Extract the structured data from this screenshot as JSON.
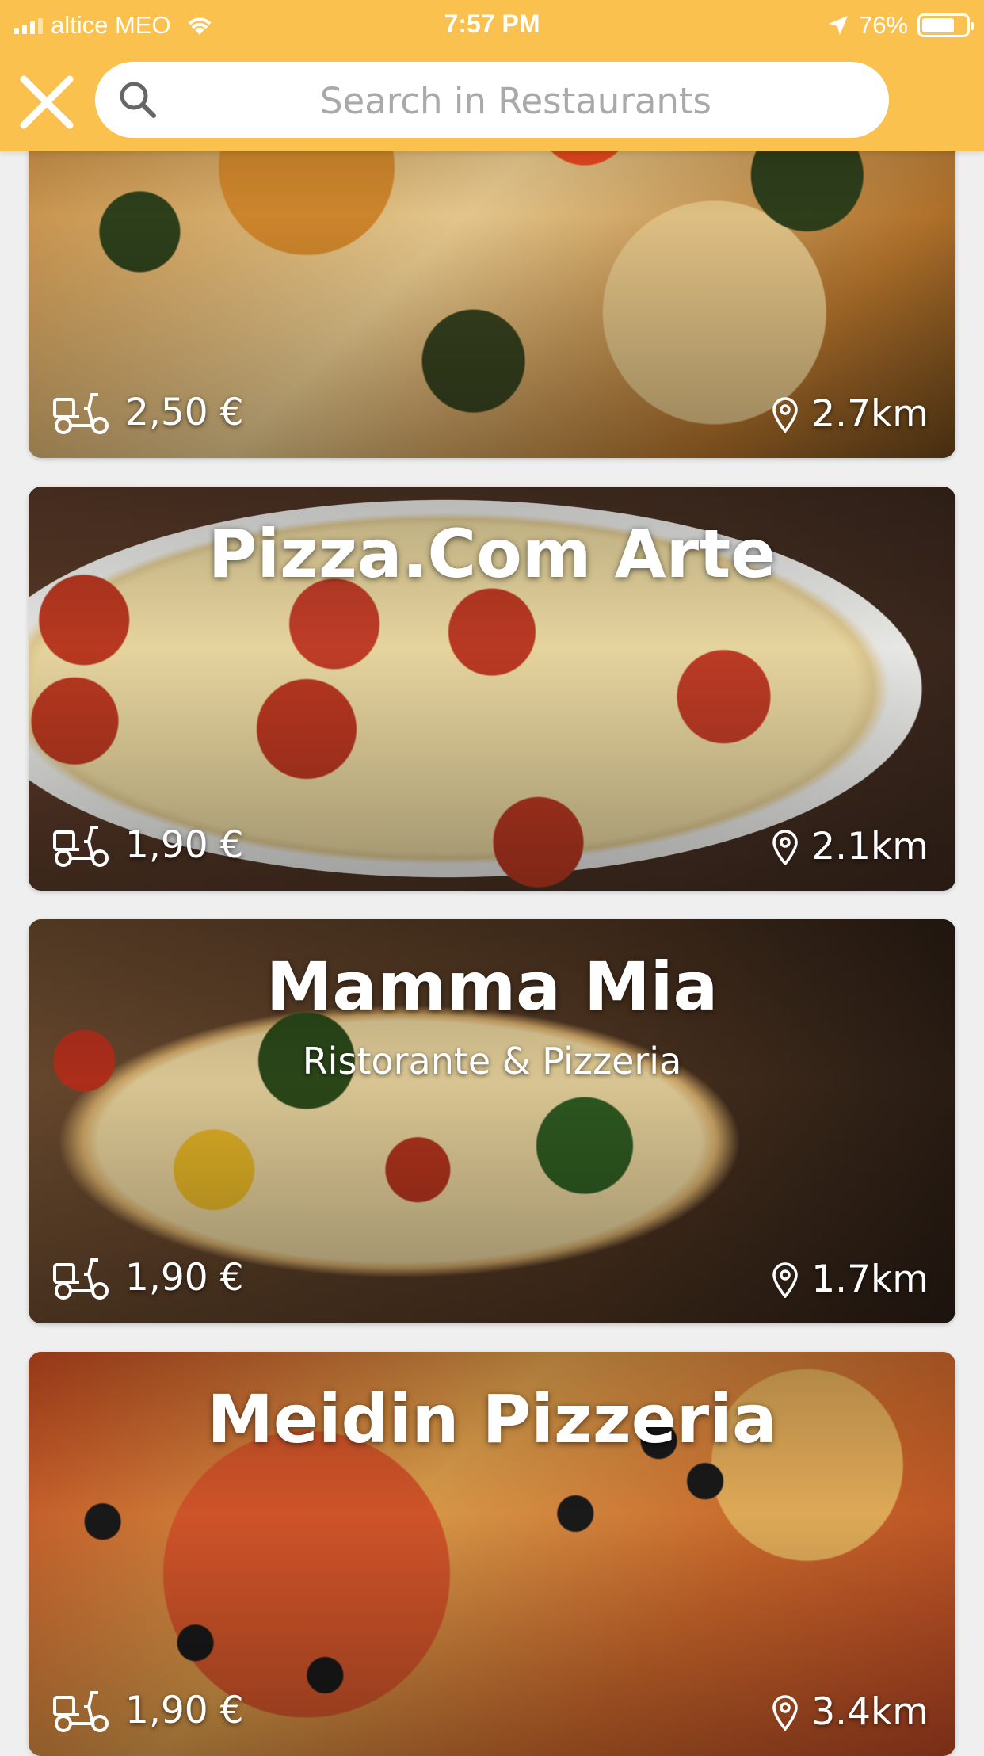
{
  "status_bar": {
    "carrier": "altice MEO",
    "time": "7:57 PM",
    "battery": "76%",
    "battery_level": 0.76
  },
  "header": {
    "search_placeholder": "Search in Restaurants",
    "close_icon": "close-icon",
    "search_icon": "search-icon",
    "background_color": "#fbc14e"
  },
  "restaurants": [
    {
      "name": "",
      "subtitle": "",
      "delivery_fee": "2,50 €",
      "distance": "2.7km"
    },
    {
      "name": "Pizza.Com Arte",
      "subtitle": "",
      "delivery_fee": "1,90 €",
      "distance": "2.1km"
    },
    {
      "name": "Mamma Mia",
      "subtitle": "Ristorante & Pizzeria",
      "delivery_fee": "1,90 €",
      "distance": "1.7km"
    },
    {
      "name": "Meidin Pizzeria",
      "subtitle": "",
      "delivery_fee": "1,90 €",
      "distance": "3.4km"
    }
  ]
}
